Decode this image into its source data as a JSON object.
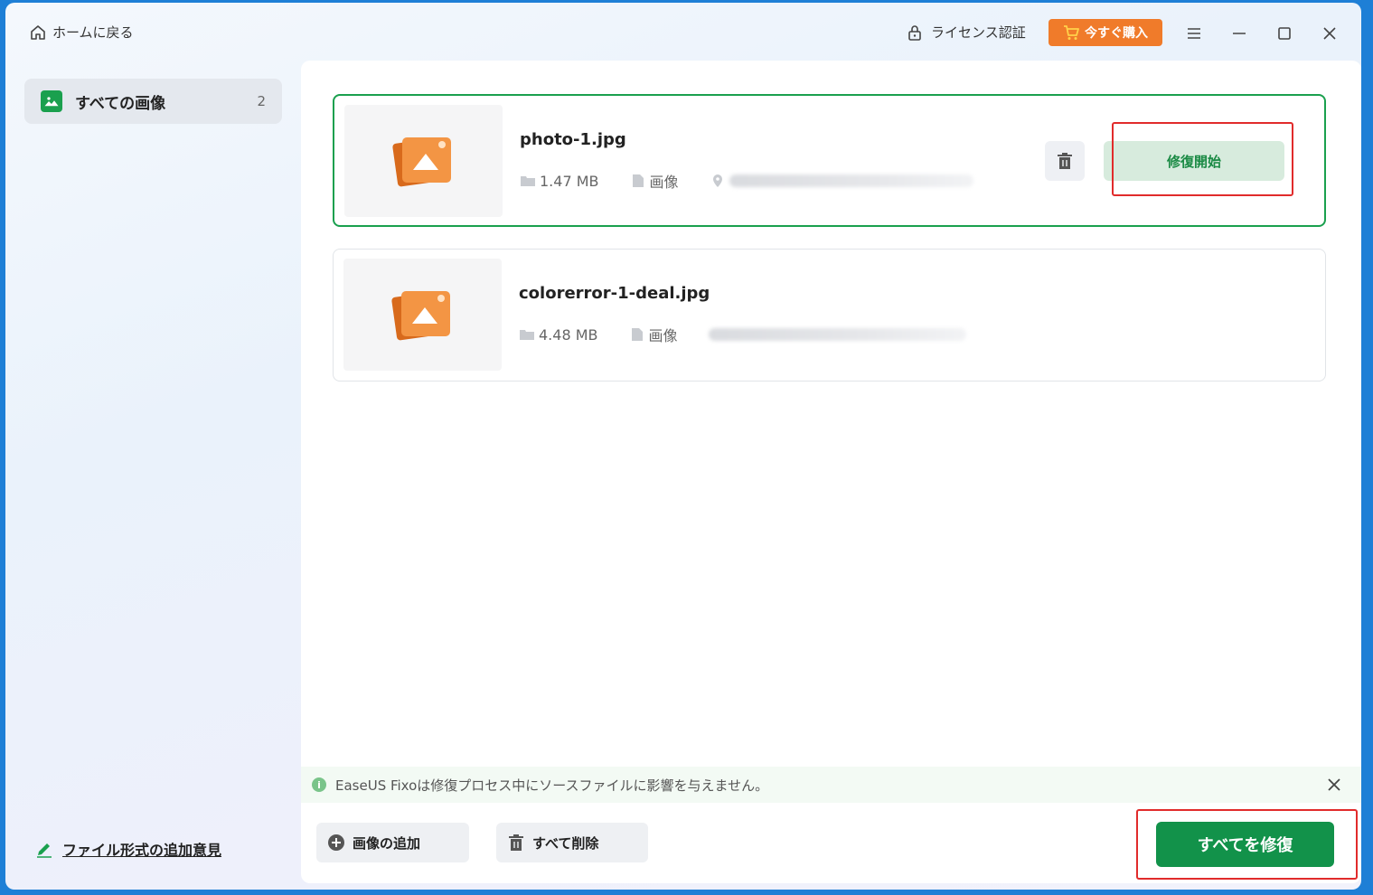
{
  "header": {
    "home_label": "ホームに戻る",
    "license_label": "ライセンス認証",
    "buy_label": "今すぐ購入"
  },
  "sidebar": {
    "items": [
      {
        "label": "すべての画像",
        "count": "2",
        "icon": "image-icon"
      }
    ],
    "feedback_label": "ファイル形式の追加意見"
  },
  "files": [
    {
      "name": "photo-1.jpg",
      "size": "1.47 MB",
      "type": "画像",
      "path": "(blurred)",
      "repair_label": "修復開始",
      "selected": true
    },
    {
      "name": "colorerror-1-deal.jpg",
      "size": "4.48 MB",
      "type": "画像",
      "path": "(blurred)",
      "selected": false
    }
  ],
  "notice": {
    "text": "EaseUS Fixoは修復プロセス中にソースファイルに影響を与えません。"
  },
  "footer": {
    "add_label": "画像の追加",
    "delete_all_label": "すべて削除",
    "repair_all_label": "すべてを修復"
  },
  "colors": {
    "accent": "#12924a",
    "buy": "#f07b2a",
    "highlight": "#e12b2b"
  }
}
